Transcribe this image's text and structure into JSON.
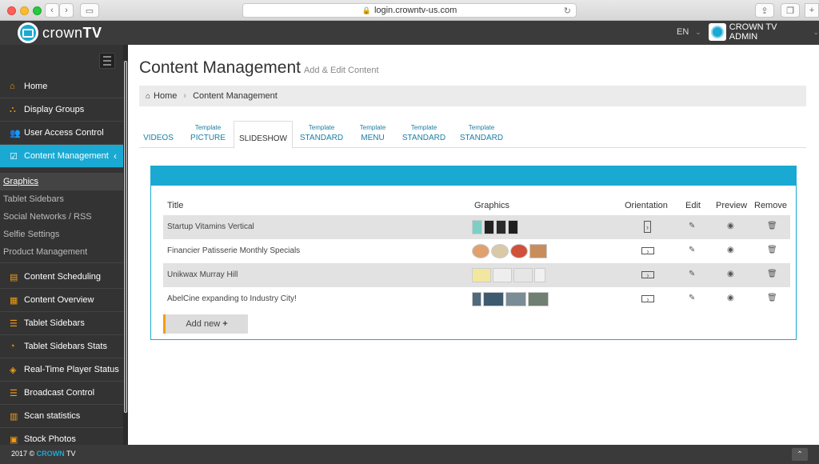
{
  "browser": {
    "url": "login.crowntv-us.com",
    "back_icon": "chevron-left-icon",
    "forward_icon": "chevron-right-icon"
  },
  "app": {
    "logo_text_light": "crown",
    "logo_text_bold": "TV",
    "language": "EN",
    "user": "CROWN TV ADMIN"
  },
  "sidebar": {
    "items_top": [
      {
        "label": "Home",
        "icon": "home-icon"
      },
      {
        "label": "Display Groups",
        "icon": "sitemap-icon"
      },
      {
        "label": "User Access Control",
        "icon": "users-icon"
      },
      {
        "label": "Content Management",
        "icon": "edit-square-icon",
        "active": true
      }
    ],
    "sub_items": [
      {
        "label": "Graphics",
        "active": true
      },
      {
        "label": "Tablet Sidebars"
      },
      {
        "label": "Social Networks / RSS"
      },
      {
        "label": "Selfie Settings"
      },
      {
        "label": "Product Management"
      }
    ],
    "items_bottom": [
      {
        "label": "Content Scheduling",
        "icon": "calendar-icon"
      },
      {
        "label": "Content Overview",
        "icon": "calendar-icon"
      },
      {
        "label": "Tablet Sidebars",
        "icon": "list-icon"
      },
      {
        "label": "Tablet Sidebars Stats",
        "icon": "pie-chart-icon"
      },
      {
        "label": "Real-Time Player Status",
        "icon": "cube-icon"
      },
      {
        "label": "Broadcast Control",
        "icon": "list-icon"
      },
      {
        "label": "Scan statistics",
        "icon": "bar-chart-icon"
      },
      {
        "label": "Stock Photos",
        "icon": "image-icon"
      }
    ]
  },
  "main": {
    "title": "Content Management",
    "subtitle": "Add & Edit Content",
    "breadcrumb": {
      "home": "Home",
      "current": "Content Management"
    },
    "tabs": [
      {
        "small": "",
        "label": "VIDEOS"
      },
      {
        "small": "Template",
        "label": "PICTURE"
      },
      {
        "small": "",
        "label": "SLIDESHOW",
        "active": true
      },
      {
        "small": "Template",
        "label": "STANDARD"
      },
      {
        "small": "Template",
        "label": "MENU"
      },
      {
        "small": "Template",
        "label": "STANDARD"
      },
      {
        "small": "Template",
        "label": "STANDARD"
      }
    ],
    "table": {
      "headers": {
        "title": "Title",
        "graphics": "Graphics",
        "orientation": "Orientation",
        "edit": "Edit",
        "preview": "Preview",
        "remove": "Remove"
      },
      "rows": [
        {
          "title": "Startup Vitamins Vertical",
          "orientation": "vertical",
          "thumb_colors": [
            "#7ccfc4",
            "#222",
            "#2a2a2a",
            "#1f1f1f"
          ]
        },
        {
          "title": "Financier Patisserie Monthly Specials",
          "orientation": "horizontal",
          "thumb_colors": [
            "#e0a070",
            "#d9c9a8",
            "#d0503a",
            "#c98d5c"
          ]
        },
        {
          "title": "Unikwax Murray Hill",
          "orientation": "horizontal",
          "thumb_colors": [
            "#f3e7a0",
            "#eeeeee",
            "#e6e6e6",
            "#f0f0f0"
          ]
        },
        {
          "title": "AbelCine expanding to Industry City!",
          "orientation": "horizontal",
          "thumb_colors": [
            "#4f6a7a",
            "#3d5a6e",
            "#7a8c96",
            "#6f7f72"
          ]
        }
      ]
    },
    "add_new": "Add new"
  },
  "footer": {
    "year": "2017 ©",
    "brand": "CROWN",
    "brand2": "TV"
  },
  "colors": {
    "accent": "#1aa9d2",
    "icon_orange": "#f39c12",
    "sidebar": "#333333"
  }
}
